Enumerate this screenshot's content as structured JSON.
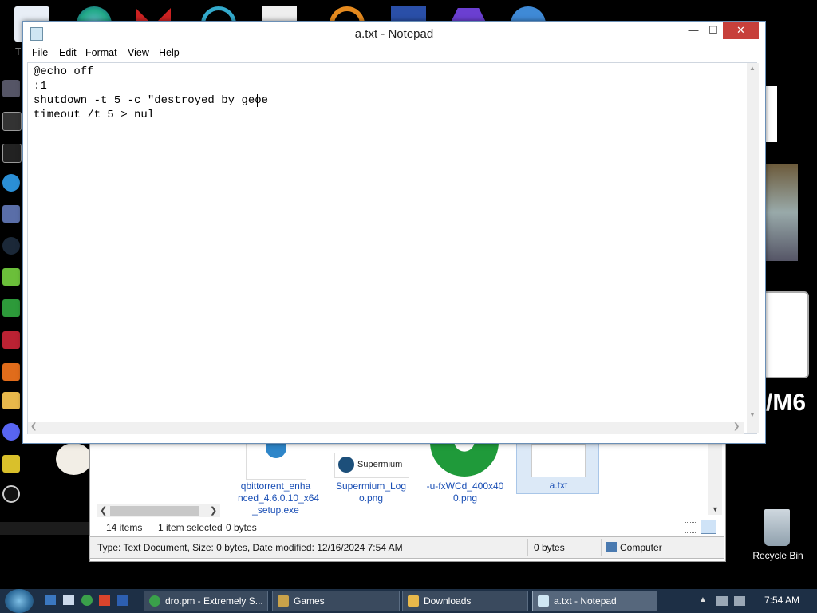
{
  "window": {
    "title": "a.txt - Notepad",
    "minimize": "—",
    "maximize": "☐",
    "close": "✕"
  },
  "menu": [
    "File",
    "Edit",
    "Format",
    "View",
    "Help"
  ],
  "editor": {
    "lines": [
      "@echo off",
      ":1",
      "shutdown -t 5 -c \"destroyed by geoe",
      "timeout /t 5 > nul"
    ]
  },
  "explorer": {
    "files": [
      {
        "name": "qbittorrent_enha nced_4.6.0.10_x64 _setup.exe",
        "lines": [
          "qbittorrent_enha",
          "nced_4.6.0.10_x64",
          "_setup.exe"
        ]
      },
      {
        "name": "Supermium_Logo.png",
        "lines": [
          "Supermium_Log",
          "o.png"
        ],
        "logo_text": "Supermium"
      },
      {
        "name": "-u-fxWCd_400x400.png",
        "lines": [
          "-u-fxWCd_400x40",
          "0.png"
        ]
      },
      {
        "name": "a.txt",
        "lines": [
          "a.txt"
        ]
      }
    ],
    "item_count": "14 items",
    "selected": "1 item selected",
    "selected_size": "0 bytes",
    "details": "Type: Text Document, Size: 0 bytes, Date modified: 12/16/2024 7:54 AM",
    "size_right": "0 bytes",
    "location": "Computer"
  },
  "desktop": {
    "recycle_bin": "Recycle Bin",
    "t_label": "T"
  },
  "taskbar": {
    "buttons": [
      "dro.pm - Extremely S...",
      "Games",
      "Downloads",
      "a.txt - Notepad"
    ],
    "clock": "7:54 AM"
  },
  "colors": {
    "taskbar": "#1d2f45",
    "link": "#1a4fb5",
    "close_button": "#c7403b"
  }
}
